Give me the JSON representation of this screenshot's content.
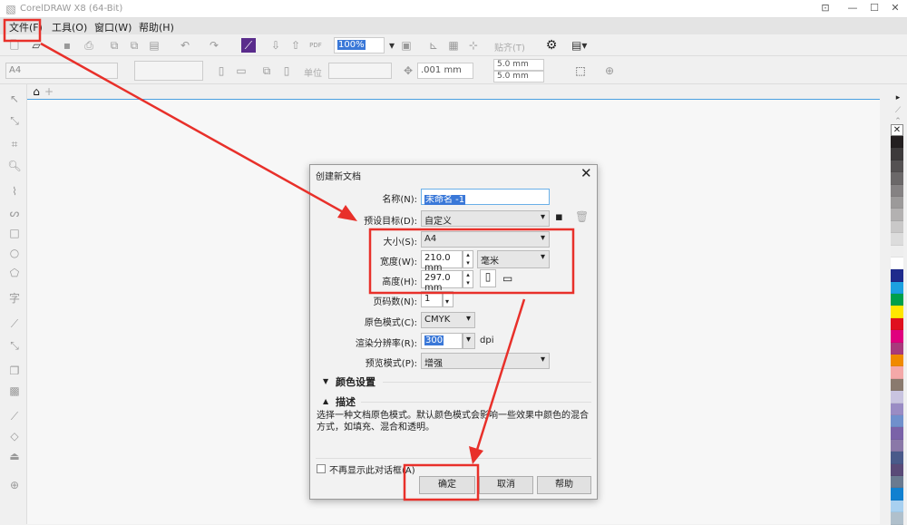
{
  "window": {
    "title": "CorelDRAW X8 (64-Bit)"
  },
  "menu": [
    {
      "label": "文件(F)"
    },
    {
      "label": "工具(O)"
    },
    {
      "label": "窗口(W)"
    },
    {
      "label": "帮助(H)"
    }
  ],
  "toolbar": {
    "zoom": "100%",
    "snap": "贴齐(T)"
  },
  "propbar": {
    "page_size": "A4",
    "units": "单位",
    "nudge": ".001 mm",
    "dup_x": "5.0 mm",
    "dup_y": "5.0 mm"
  },
  "dialog": {
    "title": "创建新文档",
    "name_label": "名称(N):",
    "name_value": "未命名 -1",
    "preset_label": "预设目标(D):",
    "preset_value": "自定义",
    "size_label": "大小(S):",
    "size_value": "A4",
    "width_label": "宽度(W):",
    "width_value": "210.0 mm",
    "unit_value": "毫米",
    "height_label": "高度(H):",
    "height_value": "297.0 mm",
    "pages_label": "页码数(N):",
    "pages_value": "1",
    "color_mode_label": "原色模式(C):",
    "color_mode_value": "CMYK",
    "resolution_label": "渲染分辨率(R):",
    "resolution_value": "300",
    "resolution_unit": "dpi",
    "preview_label": "预览模式(P):",
    "preview_value": "增强",
    "color_settings": "颜色设置",
    "description": "描述",
    "description_text": "选择一种文档原色模式。默认颜色模式会影响一些效果中颜色的混合方式，如填充、混合和透明。",
    "dont_show": "不再显示此对话框(A)",
    "ok": "确定",
    "cancel": "取消",
    "help": "帮助"
  },
  "palette": [
    "#231f20",
    "#3d3a3b",
    "#545152",
    "#6b6869",
    "#858283",
    "#9c9a9a",
    "#b3b1b1",
    "#c9c8c8",
    "#dcdcdc",
    "#eeeeee",
    "#ffffff",
    "#1e2a8c",
    "#1ca0e0",
    "#00a04a",
    "#ffe600",
    "#e0101e",
    "#e0007e",
    "#a83a7c",
    "#f08a00",
    "#f4a8a8",
    "#8a7a6e",
    "#c9c4e0",
    "#9a8cc4",
    "#7090cc",
    "#7a62a8",
    "#8a78a8",
    "#4a5a8a",
    "#5a4a78",
    "#6a7a90",
    "#1080d0",
    "#a8d0f0",
    "#b0c0cc"
  ],
  "annotation_color": "#e8302a"
}
